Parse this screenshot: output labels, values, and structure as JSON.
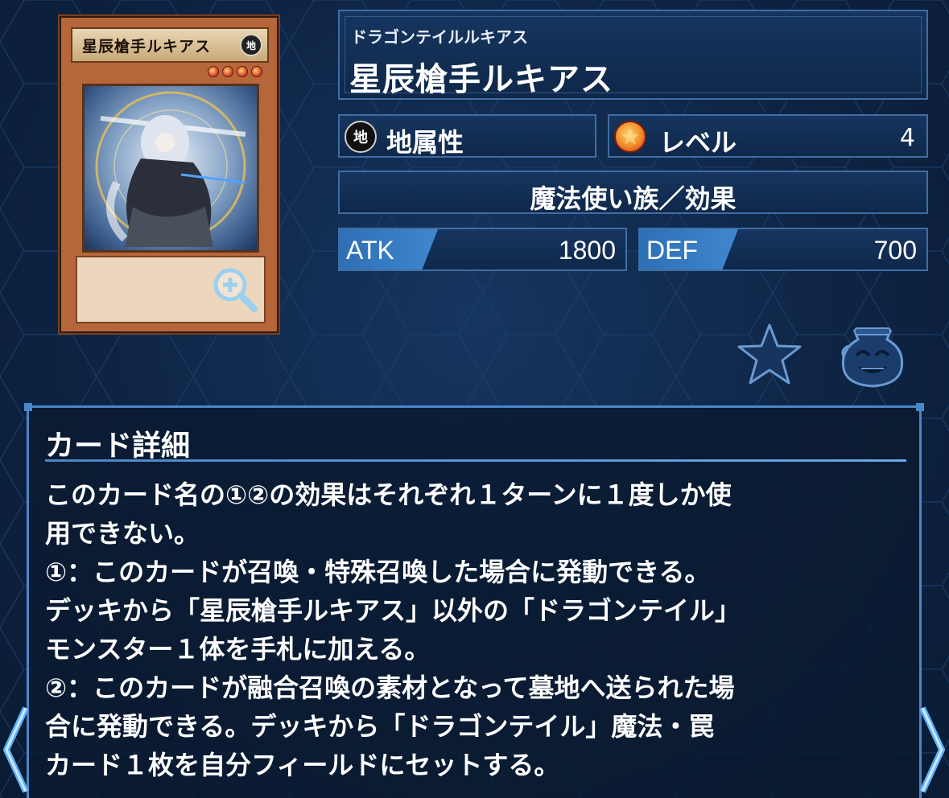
{
  "card": {
    "ruby": "ドラゴンテイルルキアス",
    "name": "星辰槍手ルキアス",
    "attribute_icon": "地",
    "attribute": "地属性",
    "level_label": "レベル",
    "level": "4",
    "type_line": "魔法使い族／効果",
    "atk_label": "ATK",
    "atk": "1800",
    "def_label": "DEF",
    "def": "700"
  },
  "card_image": {
    "title": "星辰槍手ルキアス",
    "attribute_icon": "地",
    "stars": 4
  },
  "detail": {
    "title": "カード詳細",
    "lines": [
      "このカード名の①②の効果はそれぞれ１ターンに１度しか使",
      "用できない。",
      "①：このカードが召喚・特殊召喚した場合に発動できる。",
      "デッキから「星辰槍手ルキアス」以外の「ドラゴンテイル」",
      "モンスター１体を手札に加える。",
      "②：このカードが融合召喚の素材となって墓地へ送られた場",
      "合に発動できる。デッキから「ドラゴンテイル」魔法・罠",
      "カード１枚を自分フィールドにセットする。"
    ]
  },
  "icons": {
    "zoom": "zoom-in-icon",
    "favorite": "star-icon",
    "pot": "pot-of-greed-icon",
    "prev": "chevron-left-icon",
    "next": "chevron-right-icon"
  },
  "colors": {
    "background": "#0d2240",
    "panel": "#16355f",
    "panel_border": "#3f6ea3",
    "accent": "#4a86c8",
    "stat_tag": "#3f87cf"
  }
}
